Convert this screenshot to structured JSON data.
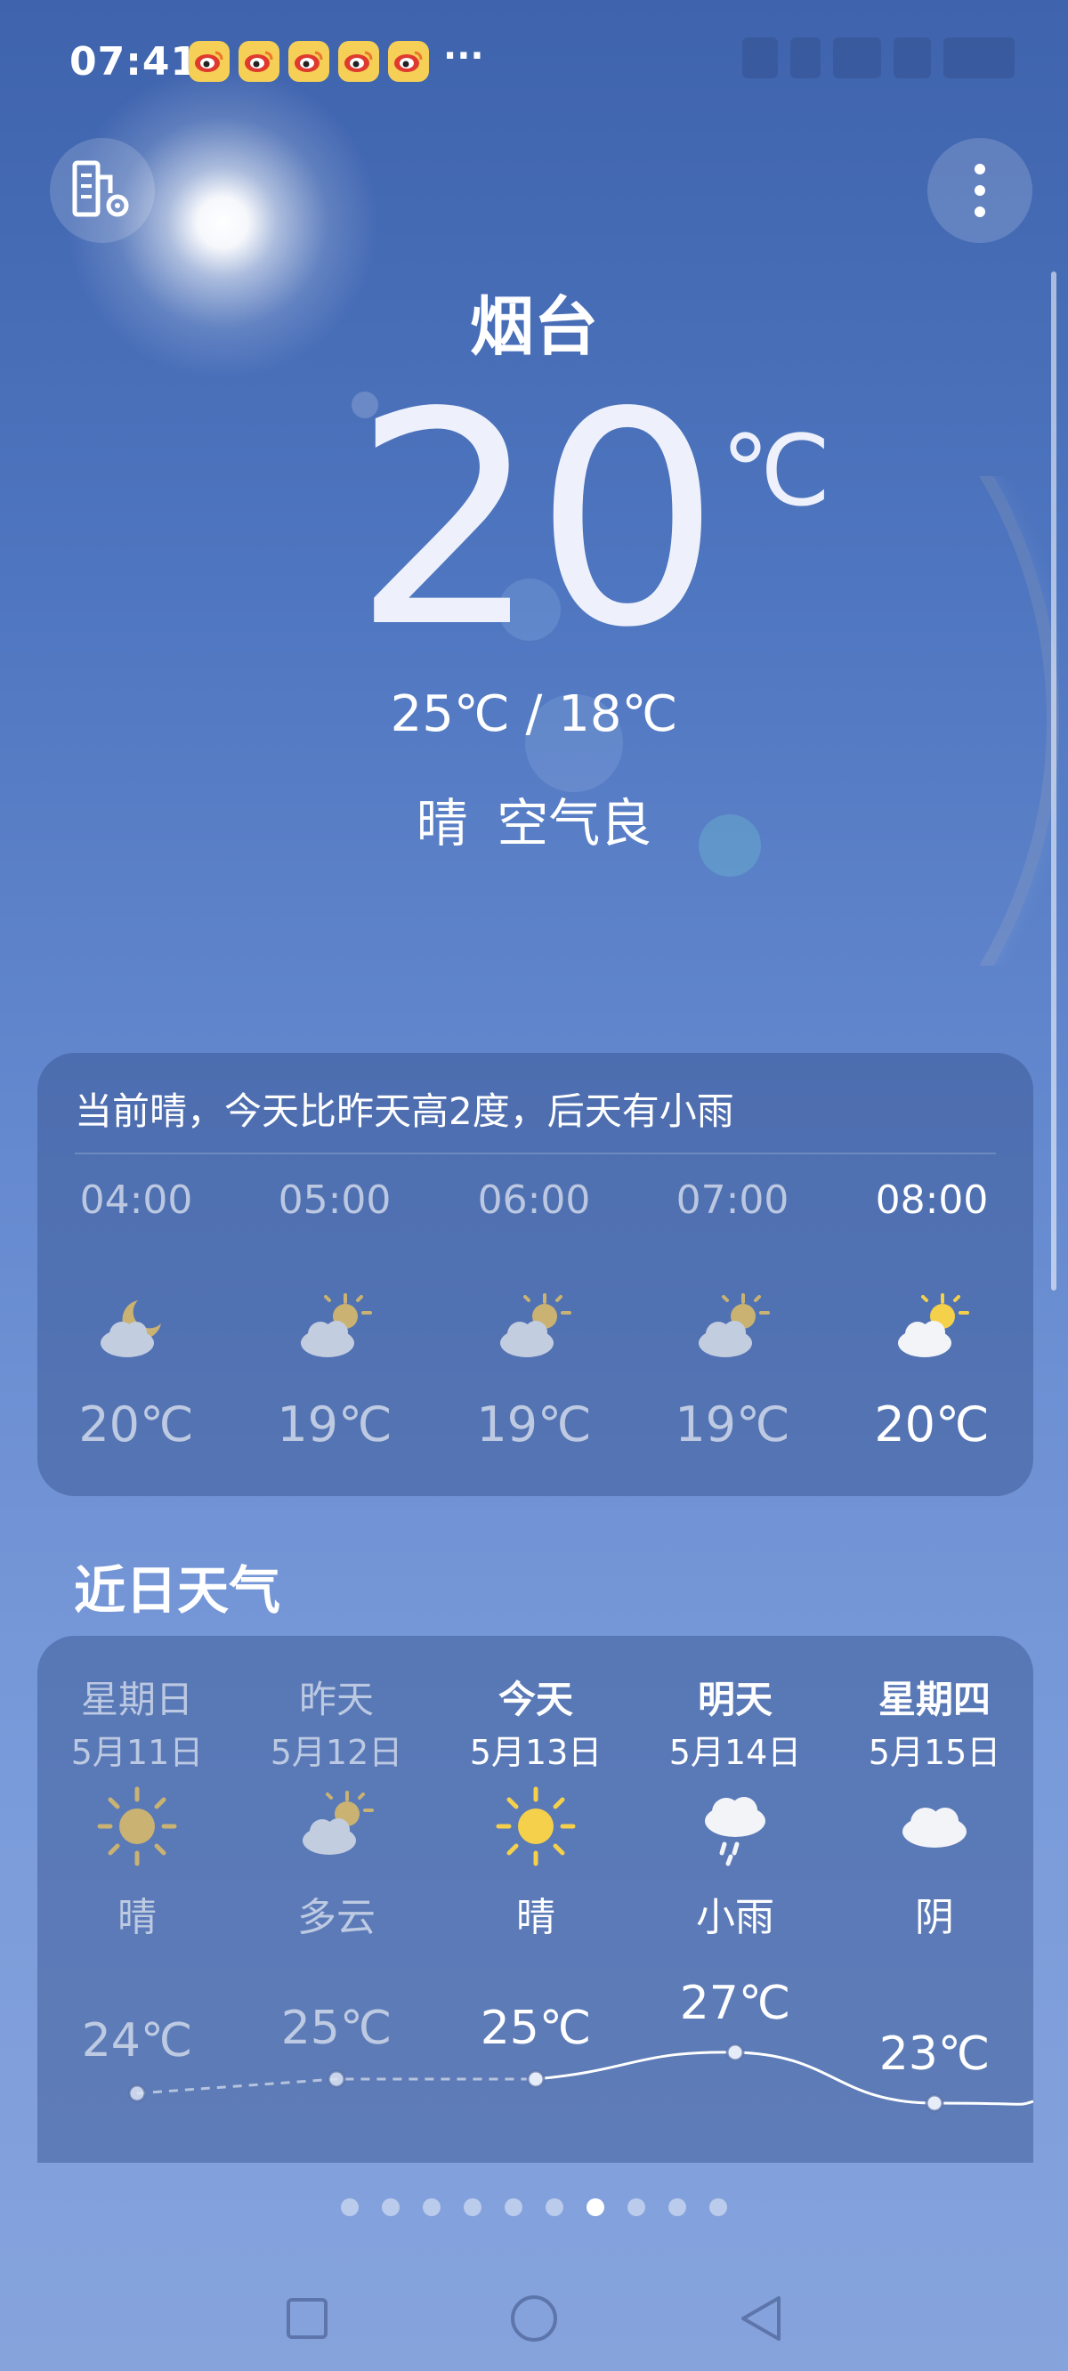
{
  "status_bar": {
    "time": "07:41",
    "notification_icons": [
      "weibo-icon",
      "weibo-icon",
      "weibo-icon",
      "weibo-icon",
      "weibo-icon"
    ],
    "more_notifications": "···"
  },
  "header": {
    "city_manage_icon": "city-manage-icon",
    "more_icon": "more-vertical-icon"
  },
  "current": {
    "city": "烟台",
    "temperature": "20",
    "unit": "℃",
    "range": "25℃ / 18℃",
    "condition": "晴  空气良"
  },
  "hourly": {
    "summary": "当前晴，今天比昨天高2度，后天有小雨",
    "items": [
      {
        "time": "04:00",
        "icon": "moon-cloud-icon",
        "temp": "20℃"
      },
      {
        "time": "05:00",
        "icon": "sun-cloud-icon",
        "temp": "19℃"
      },
      {
        "time": "06:00",
        "icon": "sun-cloud-icon",
        "temp": "19℃"
      },
      {
        "time": "07:00",
        "icon": "sun-cloud-icon",
        "temp": "19℃"
      },
      {
        "time": "08:00",
        "icon": "sun-cloud-icon",
        "temp": "20℃"
      }
    ]
  },
  "daily": {
    "title": "近日天气",
    "items": [
      {
        "day": "星期日",
        "date": "5月11日",
        "icon": "sun-icon",
        "condition": "晴",
        "high": "24℃",
        "high_value": 24
      },
      {
        "day": "昨天",
        "date": "5月12日",
        "icon": "sun-cloud-icon",
        "condition": "多云",
        "high": "25℃",
        "high_value": 25
      },
      {
        "day": "今天",
        "date": "5月13日",
        "icon": "sun-icon",
        "condition": "晴",
        "high": "25℃",
        "high_value": 25
      },
      {
        "day": "明天",
        "date": "5月14日",
        "icon": "rain-cloud-icon",
        "condition": "小雨",
        "high": "27℃",
        "high_value": 27
      },
      {
        "day": "星期四",
        "date": "5月15日",
        "icon": "cloud-icon",
        "condition": "阴",
        "high": "23℃",
        "high_value": 23
      }
    ]
  },
  "pager": {
    "total": 10,
    "active": 7
  },
  "colors": {
    "sun": "#f5d04a",
    "sun_dim": "#c9b272",
    "cloud": "#f2f4f8",
    "cloud_dim": "#c3cde0"
  }
}
